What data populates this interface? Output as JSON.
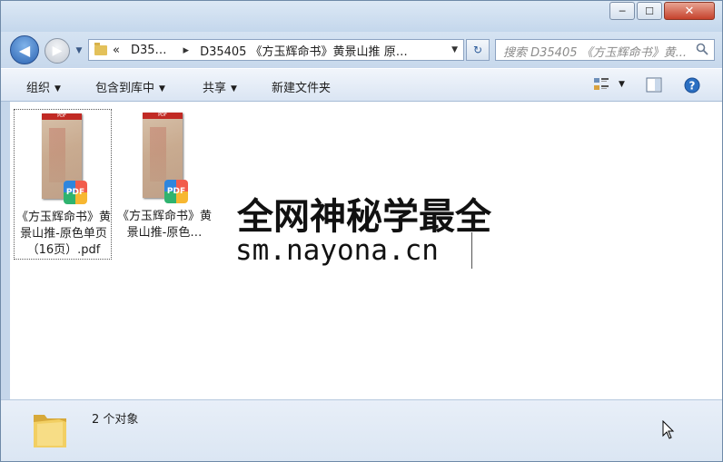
{
  "window": {
    "minimize_label": "─",
    "maximize_label": "☐",
    "close_label": "✕"
  },
  "nav": {
    "back_glyph": "◀",
    "forward_glyph": "▶",
    "dropdown_glyph": "▼",
    "address": {
      "prefix": "«",
      "segment_1": "D35…",
      "sep": "▸",
      "segment_2": "D35405 《方玉辉命书》黄景山推 原…",
      "dropdown_glyph": "▼"
    },
    "refresh_glyph": "↻",
    "search_placeholder": "搜索 D35405 《方玉辉命书》黄..."
  },
  "toolbar": {
    "organize": "组织",
    "include_library": "包含到库中",
    "share": "共享",
    "new_folder": "新建文件夹",
    "caret": "▼"
  },
  "files": [
    {
      "name": "《方玉辉命书》黄景山推-原色单页（16页）.pdf",
      "badge": "PDF",
      "thumb_label": "PDF"
    },
    {
      "name": "《方玉辉命书》黄景山推-原色…",
      "badge": "PDF",
      "thumb_label": "PDF"
    }
  ],
  "overlay": {
    "line1": "全网神秘学最全",
    "line2": "sm.nayona.cn"
  },
  "status": {
    "count_text": "2 个对象"
  },
  "colors": {
    "chrome": "#c5d6ea",
    "close": "#c6422c",
    "pdf_red": "#c12a24"
  },
  "icons": [
    "back-arrow-icon",
    "forward-arrow-icon",
    "folder-icon",
    "refresh-icon",
    "search-icon",
    "view-options-icon",
    "preview-pane-icon",
    "help-icon",
    "pdf-icon",
    "mouse-cursor-icon"
  ]
}
